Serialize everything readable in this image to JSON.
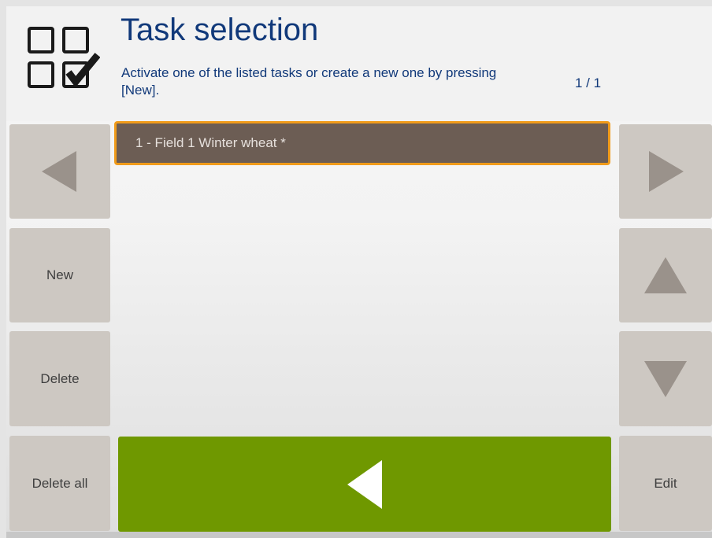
{
  "header": {
    "title": "Task selection",
    "subtitle": "Activate one of the listed tasks or create a new one by pressing [New].",
    "page_indicator": "1 / 1",
    "icon": "task-checklist-icon"
  },
  "tasks": [
    {
      "label": "1 - Field 1 Winter wheat *",
      "selected": true
    }
  ],
  "left_buttons": {
    "prev_icon": "arrow-left-icon",
    "new_label": "New",
    "delete_label": "Delete",
    "delete_all_label": "Delete all"
  },
  "right_buttons": {
    "next_icon": "arrow-right-icon",
    "up_icon": "arrow-up-icon",
    "down_icon": "arrow-down-icon",
    "edit_label": "Edit"
  },
  "confirm": {
    "icon": "back-arrow-icon"
  },
  "colors": {
    "title": "#11397a",
    "selection_border": "#f09b1a",
    "list_item_bg": "#6c5d54",
    "confirm_bg": "#6f9800",
    "button_bg": "#cdc8c2",
    "arrow_gray": "#9a928b"
  }
}
